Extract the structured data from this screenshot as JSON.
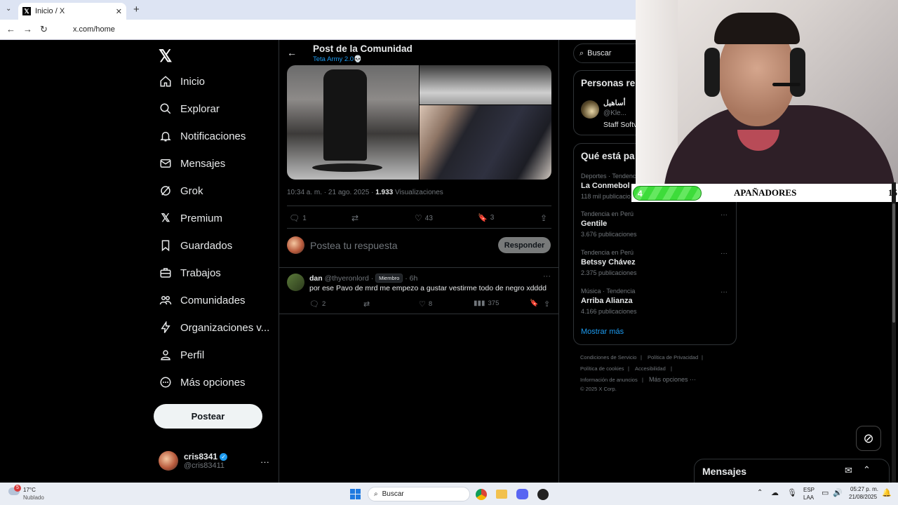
{
  "browser": {
    "tab_title": "Inicio / X",
    "url": "x.com/home"
  },
  "nav": {
    "items": [
      {
        "label": "Inicio",
        "icon": "home-icon"
      },
      {
        "label": "Explorar",
        "icon": "search-icon"
      },
      {
        "label": "Notificaciones",
        "icon": "bell-icon"
      },
      {
        "label": "Mensajes",
        "icon": "envelope-icon"
      },
      {
        "label": "Grok",
        "icon": "grok-icon"
      },
      {
        "label": "Premium",
        "icon": "x-icon"
      },
      {
        "label": "Guardados",
        "icon": "bookmark-icon"
      },
      {
        "label": "Trabajos",
        "icon": "briefcase-icon"
      },
      {
        "label": "Comunidades",
        "icon": "people-icon"
      },
      {
        "label": "Organizaciones v...",
        "icon": "bolt-icon"
      },
      {
        "label": "Perfil",
        "icon": "person-icon"
      },
      {
        "label": "Más opciones",
        "icon": "more-circle-icon"
      }
    ],
    "post_button": "Postear",
    "account": {
      "name": "cris8341",
      "handle": "@cris83411"
    }
  },
  "post": {
    "header_title": "Post de la Comunidad",
    "community": "Teta Army 2.0💀",
    "time": "10:34 a. m. · 21 ago. 2025 ·",
    "views_count": "1.933",
    "views_label": "Visualizaciones",
    "replies": "1",
    "likes": "43",
    "bookmarks": "3",
    "reply_placeholder": "Postea tu respuesta",
    "reply_button": "Responder"
  },
  "reply_item": {
    "name": "dan",
    "handle": "@thyeronlord",
    "badge": "Miembro",
    "time": "· 6h",
    "text": "por ese Pavo de mrd me empezo a gustar vestirme todo de negro xdddd",
    "replies": "2",
    "likes": "8",
    "views": "375"
  },
  "right": {
    "search_placeholder": "Buscar",
    "people_title": "Personas re",
    "person": {
      "name": "أساهيل",
      "handle": "@Kle...",
      "bio": "Staff Softv"
    },
    "trends_title": "Qué está pa",
    "trends": [
      {
        "meta": "Deportes · Tendenc",
        "name": "La Conmebol",
        "count": "118 mil publicacio"
      },
      {
        "meta": "Tendencia en Perú",
        "name": "Gentile",
        "count": "3.676 publicaciones"
      },
      {
        "meta": "Tendencia en Perú",
        "name": "Betssy Chávez",
        "count": "2.375 publicaciones"
      },
      {
        "meta": "Música · Tendencia",
        "name": "Arriba Alianza",
        "count": "4.166 publicaciones"
      }
    ],
    "show_more": "Mostrar más",
    "footer": {
      "terms": "Condiciones de Servicio",
      "privacy": "Política de Privacidad",
      "cookies": "Política de cookies",
      "accessibility": "Accesibilidad",
      "ads": "Información de anuncios",
      "more": "Más opciones ···",
      "copyright": "© 2025 X Corp."
    }
  },
  "overlay": {
    "left_number": "4",
    "label": "APAÑADORES",
    "right_number": "15",
    "progress_fraction": 0.26
  },
  "messages_panel": {
    "title": "Mensajes"
  },
  "taskbar": {
    "weather_temp": "17°C",
    "weather_desc": "Nublado",
    "weather_badge": "5",
    "search": "Buscar",
    "lang1": "ESP",
    "lang2": "LAA",
    "time": "05:27 p. m.",
    "date": "21/08/2025"
  }
}
